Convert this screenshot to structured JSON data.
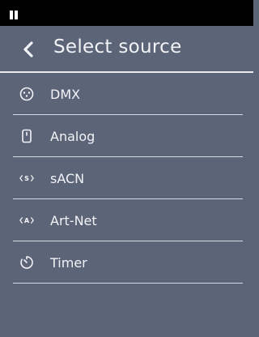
{
  "header": {
    "title": "Select source",
    "back_icon": "chevron-left-icon"
  },
  "menu": {
    "items": [
      {
        "label": "DMX",
        "icon": "dmx-connector-icon"
      },
      {
        "label": "Analog",
        "icon": "analog-input-icon"
      },
      {
        "label": "sACN",
        "icon": "sacn-icon"
      },
      {
        "label": "Art-Net",
        "icon": "art-net-icon"
      },
      {
        "label": "Timer",
        "icon": "timer-icon"
      }
    ]
  },
  "colors": {
    "background": "#5c6478",
    "statusbar": "#000000",
    "text": "#f2f3f6",
    "divider": "#d9dbe2"
  }
}
